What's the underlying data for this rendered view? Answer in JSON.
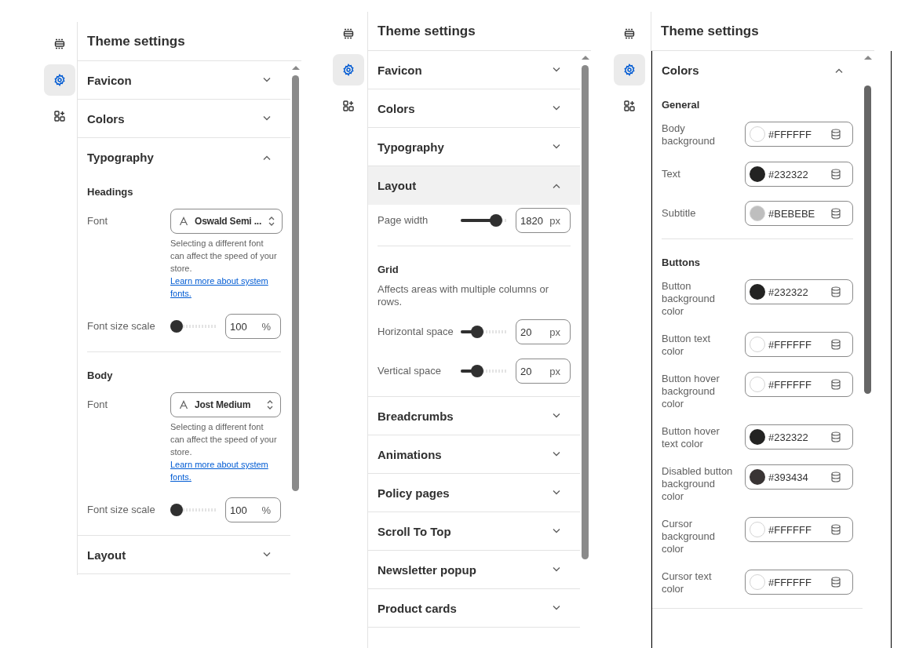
{
  "panels": [
    {
      "title": "Theme settings",
      "rail": [
        {
          "selected": false
        },
        {
          "selected": true
        },
        {
          "selected": false
        }
      ],
      "sections": [
        {
          "title": "Favicon",
          "expanded": false,
          "highlighted": false
        },
        {
          "title": "Colors",
          "expanded": false,
          "highlighted": false
        },
        {
          "title": "Typography",
          "expanded": true,
          "highlighted": false,
          "groups": [
            {
              "heading": "Headings",
              "items": [
                {
                  "kind": "font",
                  "label": "Font",
                  "value": "Oswald Semi ...",
                  "help": "Selecting a different font can affect the speed of your store.",
                  "link": "Learn more about system fonts."
                },
                {
                  "kind": "slider",
                  "label": "Font size scale",
                  "level": 0,
                  "value": "100",
                  "unit": "%"
                }
              ]
            },
            {
              "heading": "Body",
              "items": [
                {
                  "kind": "font",
                  "label": "Font",
                  "value": "Jost Medium",
                  "help": "Selecting a different font can affect the speed of your store.",
                  "link": "Learn more about system fonts."
                },
                {
                  "kind": "slider",
                  "label": "Font size scale",
                  "level": 0,
                  "value": "100",
                  "unit": "%"
                }
              ]
            }
          ]
        },
        {
          "title": "Layout",
          "expanded": false,
          "highlighted": false
        }
      ]
    },
    {
      "title": "Theme settings",
      "rail": [
        {
          "selected": false
        },
        {
          "selected": true
        },
        {
          "selected": false
        }
      ],
      "sections": [
        {
          "title": "Favicon",
          "expanded": false,
          "highlighted": false
        },
        {
          "title": "Colors",
          "expanded": false,
          "highlighted": false
        },
        {
          "title": "Typography",
          "expanded": false,
          "highlighted": false
        },
        {
          "title": "Layout",
          "expanded": true,
          "highlighted": true,
          "groups": [
            {
              "items": [
                {
                  "kind": "slider",
                  "label": "Page width",
                  "level": 0.85,
                  "value": "1820",
                  "unit": "px"
                }
              ]
            },
            {
              "heading": "Grid",
              "note": "Affects areas with multiple columns or rows.",
              "items": [
                {
                  "kind": "slider",
                  "label": "Horizontal space",
                  "level": 0.3,
                  "value": "20",
                  "unit": "px"
                },
                {
                  "kind": "slider",
                  "label": "Vertical space",
                  "level": 0.3,
                  "value": "20",
                  "unit": "px"
                }
              ]
            }
          ]
        },
        {
          "title": "Breadcrumbs",
          "expanded": false,
          "highlighted": false
        },
        {
          "title": "Animations",
          "expanded": false,
          "highlighted": false
        },
        {
          "title": "Policy pages",
          "expanded": false,
          "highlighted": false
        },
        {
          "title": "Scroll To Top",
          "expanded": false,
          "highlighted": false
        },
        {
          "title": "Newsletter popup",
          "expanded": false,
          "highlighted": false
        },
        {
          "title": "Product cards",
          "expanded": false,
          "highlighted": false
        }
      ]
    },
    {
      "title": "Theme settings",
      "rail": [
        {
          "selected": false
        },
        {
          "selected": true
        },
        {
          "selected": false
        }
      ],
      "sections": [
        {
          "title": "Colors",
          "expanded": true,
          "highlighted": false,
          "groups": [
            {
              "heading": "General",
              "items": [
                {
                  "kind": "color",
                  "label": "Body background",
                  "value": "#FFFFFF",
                  "color": "#ffffff"
                },
                {
                  "kind": "color",
                  "label": "Text",
                  "value": "#232322",
                  "color": "#232322"
                },
                {
                  "kind": "color",
                  "label": "Subtitle",
                  "value": "#BEBEBE",
                  "color": "#bebebe"
                }
              ]
            },
            {
              "heading": "Buttons",
              "items": [
                {
                  "kind": "color",
                  "label": "Button background color",
                  "value": "#232322",
                  "color": "#232322"
                },
                {
                  "kind": "color",
                  "label": "Button text color",
                  "value": "#FFFFFF",
                  "color": "#ffffff"
                },
                {
                  "kind": "color",
                  "label": "Button hover background color",
                  "value": "#FFFFFF",
                  "color": "#ffffff"
                },
                {
                  "kind": "color",
                  "label": "Button hover text color",
                  "value": "#232322",
                  "color": "#232322"
                },
                {
                  "kind": "color",
                  "label": "Disabled button background color",
                  "value": "#393434",
                  "color": "#393434"
                },
                {
                  "kind": "color",
                  "label": "Cursor background color",
                  "value": "#FFFFFF",
                  "color": "#ffffff"
                },
                {
                  "kind": "color",
                  "label": "Cursor text color",
                  "value": "#FFFFFF",
                  "color": "#ffffff"
                }
              ]
            }
          ]
        }
      ]
    }
  ]
}
